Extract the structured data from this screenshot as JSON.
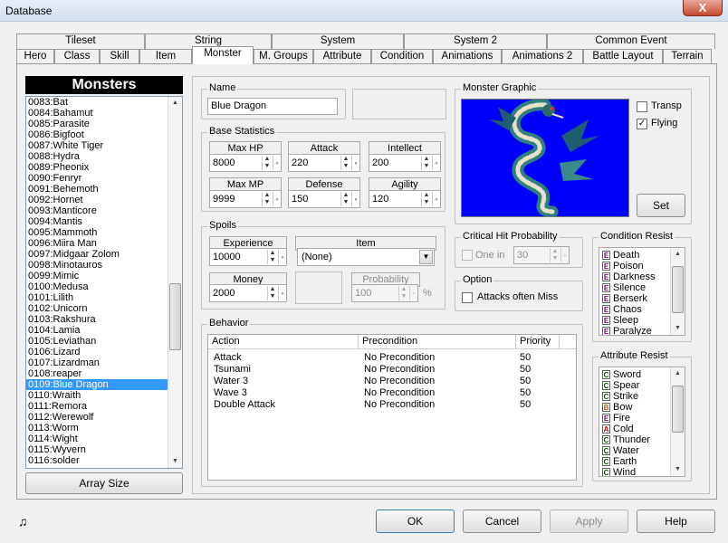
{
  "window": {
    "title": "Database",
    "close": "X"
  },
  "tabs_row1": [
    "Tileset",
    "String",
    "System",
    "System 2",
    "Common Event"
  ],
  "tabs_row2": [
    "Hero",
    "Class",
    "Skill",
    "Item",
    "Monster",
    "M. Groups",
    "Attribute",
    "Condition",
    "Animations",
    "Animations 2",
    "Battle Layout",
    "Terrain"
  ],
  "monsters": {
    "header": "Monsters",
    "items": [
      "0083:Bat",
      "0084:Bahamut",
      "0085:Parasite",
      "0086:Bigfoot",
      "0087:White Tiger",
      "0088:Hydra",
      "0089:Pheonix",
      "0090:Fenryr",
      "0091:Behemoth",
      "0092:Hornet",
      "0093:Manticore",
      "0094:Mantis",
      "0095:Mammoth",
      "0096:Miira Man",
      "0097:Midgaar Zolom",
      "0098:Minotauros",
      "0099:Mimic",
      "0100:Medusa",
      "0101:Lilith",
      "0102:Unicorn",
      "0103:Rakshura",
      "0104:Lamia",
      "0105:Leviathan",
      "0106:Lizard",
      "0107:Lizardman",
      "0108:reaper",
      "0109:Blue Dragon",
      "0110:Wraith",
      "0111:Remora",
      "0112:Werewolf",
      "0113:Worm",
      "0114:Wight",
      "0115:Wyvern",
      "0116:solder"
    ],
    "selected_index": 26,
    "array_size": "Array Size"
  },
  "name": {
    "label": "Name",
    "value": "Blue Dragon"
  },
  "base_stats": {
    "label": "Base Statistics",
    "max_hp": {
      "label": "Max HP",
      "value": "8000"
    },
    "attack": {
      "label": "Attack",
      "value": "220"
    },
    "intellect": {
      "label": "Intellect",
      "value": "200"
    },
    "max_mp": {
      "label": "Max MP",
      "value": "9999"
    },
    "defense": {
      "label": "Defense",
      "value": "150"
    },
    "agility": {
      "label": "Agility",
      "value": "120"
    }
  },
  "spoils": {
    "label": "Spoils",
    "experience": {
      "label": "Experience",
      "value": "10000"
    },
    "item": {
      "label": "Item",
      "value": "(None)"
    },
    "money": {
      "label": "Money",
      "value": "2000"
    },
    "probability": {
      "label": "Probability",
      "value": "100",
      "unit": "%"
    }
  },
  "graphic": {
    "label": "Monster Graphic",
    "transp": "Transp",
    "flying": "Flying",
    "set": "Set",
    "bg_color": "#0000ff"
  },
  "critical": {
    "label": "Critical Hit Probability",
    "one_in": "One in",
    "value": "30"
  },
  "option": {
    "label": "Option",
    "attacks_miss": "Attacks often Miss"
  },
  "behavior": {
    "label": "Behavior",
    "columns": [
      "Action",
      "Precondition",
      "Priority"
    ],
    "rows": [
      [
        "Attack",
        "No Precondition",
        "50"
      ],
      [
        "Tsunami",
        "No Precondition",
        "50"
      ],
      [
        "Water 3",
        "No Precondition",
        "50"
      ],
      [
        "Wave 3",
        "No Precondition",
        "50"
      ],
      [
        "Double Attack",
        "No Precondition",
        "50"
      ]
    ]
  },
  "condition_resist": {
    "label": "Condition Resist",
    "items": [
      [
        "E",
        "Death"
      ],
      [
        "E",
        "Poison"
      ],
      [
        "E",
        "Darkness"
      ],
      [
        "E",
        "Silence"
      ],
      [
        "E",
        "Berserk"
      ],
      [
        "E",
        "Chaos"
      ],
      [
        "E",
        "Sleep"
      ],
      [
        "E",
        "Paralyze"
      ]
    ]
  },
  "attribute_resist": {
    "label": "Attribute Resist",
    "items": [
      [
        "C",
        "Sword"
      ],
      [
        "C",
        "Spear"
      ],
      [
        "C",
        "Strike"
      ],
      [
        "B",
        "Bow"
      ],
      [
        "E",
        "Fire"
      ],
      [
        "A",
        "Cold"
      ],
      [
        "C",
        "Thunder"
      ],
      [
        "C",
        "Water"
      ],
      [
        "C",
        "Earth"
      ],
      [
        "C",
        "Wind"
      ]
    ]
  },
  "badge_colors": {
    "A": "#c00000",
    "B": "#c06000",
    "C": "#006000",
    "E": "#800080"
  },
  "footer": {
    "ok": "OK",
    "cancel": "Cancel",
    "apply": "Apply",
    "help": "Help"
  }
}
